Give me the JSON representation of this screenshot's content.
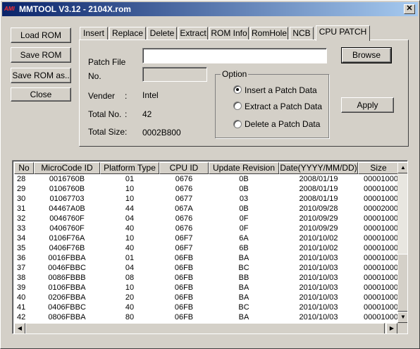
{
  "window": {
    "title": "MMTOOL V3.12 - 2104X.rom",
    "icon_text": "AMI",
    "close_glyph": "✕"
  },
  "left_buttons": {
    "load": "Load ROM",
    "save": "Save ROM",
    "save_as": "Save ROM as..",
    "close": "Close"
  },
  "tabs": [
    "Insert",
    "Replace",
    "Delete",
    "Extract",
    "ROM Info",
    "RomHole",
    "NCB",
    "CPU PATCH"
  ],
  "active_tab": "CPU PATCH",
  "patch": {
    "patch_file_label": "Patch File",
    "patch_file_value": "",
    "no_label": "No.",
    "no_value": "",
    "vender_label": "Vender",
    "vender_sep": ":",
    "vender_value": "Intel",
    "total_no_label": "Total No.",
    "total_no_sep": ":",
    "total_no_value": "42",
    "total_size_label": "Total Size",
    "total_size_sep": ":",
    "total_size_value": "0002B800",
    "browse": "Browse",
    "apply": "Apply",
    "option_legend": "Option",
    "options": [
      "Insert a Patch Data",
      "Extract a Patch Data",
      "Delete a Patch Data"
    ],
    "selected_option": 0
  },
  "table": {
    "columns": [
      "No",
      "MicroCode ID",
      "Platform Type",
      "CPU ID",
      "Update Revision",
      "Date(YYYY/MM/DD)",
      "Size"
    ],
    "rows": [
      [
        "28",
        "0016760B",
        "01",
        "0676",
        "0B",
        "2008/01/19",
        "00001000"
      ],
      [
        "29",
        "0106760B",
        "10",
        "0676",
        "0B",
        "2008/01/19",
        "00001000"
      ],
      [
        "30",
        "01067703",
        "10",
        "0677",
        "03",
        "2008/01/19",
        "00001000"
      ],
      [
        "31",
        "04467A0B",
        "44",
        "067A",
        "0B",
        "2010/09/28",
        "00002000"
      ],
      [
        "32",
        "0046760F",
        "04",
        "0676",
        "0F",
        "2010/09/29",
        "00001000"
      ],
      [
        "33",
        "0406760F",
        "40",
        "0676",
        "0F",
        "2010/09/29",
        "00001000"
      ],
      [
        "34",
        "0106F76A",
        "10",
        "06F7",
        "6A",
        "2010/10/02",
        "00001000"
      ],
      [
        "35",
        "0406F76B",
        "40",
        "06F7",
        "6B",
        "2010/10/02",
        "00001000"
      ],
      [
        "36",
        "0016FBBA",
        "01",
        "06FB",
        "BA",
        "2010/10/03",
        "00001000"
      ],
      [
        "37",
        "0046FBBC",
        "04",
        "06FB",
        "BC",
        "2010/10/03",
        "00001000"
      ],
      [
        "38",
        "0086FBBB",
        "08",
        "06FB",
        "BB",
        "2010/10/03",
        "00001000"
      ],
      [
        "39",
        "0106FBBA",
        "10",
        "06FB",
        "BA",
        "2010/10/03",
        "00001000"
      ],
      [
        "40",
        "0206FBBA",
        "20",
        "06FB",
        "BA",
        "2010/10/03",
        "00001000"
      ],
      [
        "41",
        "0406FBBC",
        "40",
        "06FB",
        "BC",
        "2010/10/03",
        "00001000"
      ],
      [
        "42",
        "0806FBBA",
        "80",
        "06FB",
        "BA",
        "2010/10/03",
        "00001000"
      ]
    ]
  },
  "scroll": {
    "up": "▲",
    "down": "▼",
    "left": "◀",
    "right": "▶"
  }
}
